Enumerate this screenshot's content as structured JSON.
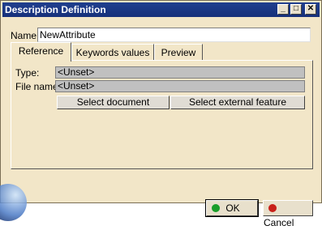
{
  "window": {
    "title": "Description Definition"
  },
  "titlebar_buttons": {
    "minimize": "_",
    "maximize": "□",
    "close": "✕"
  },
  "name": {
    "label": "Name:",
    "value": "NewAttribute"
  },
  "tabs": [
    {
      "label": "Reference"
    },
    {
      "label": "Keywords values"
    },
    {
      "label": "Preview"
    }
  ],
  "reference": {
    "type_label": "Type:",
    "type_value": "<Unset>",
    "file_label": "File name:",
    "file_value": "<Unset>",
    "select_document": "Select document",
    "select_external": "Select external feature"
  },
  "buttons": {
    "ok": "OK",
    "cancel": "Cancel"
  },
  "colors": {
    "ok_icon": "#1a9e2a",
    "cancel_icon": "#c8201a"
  }
}
